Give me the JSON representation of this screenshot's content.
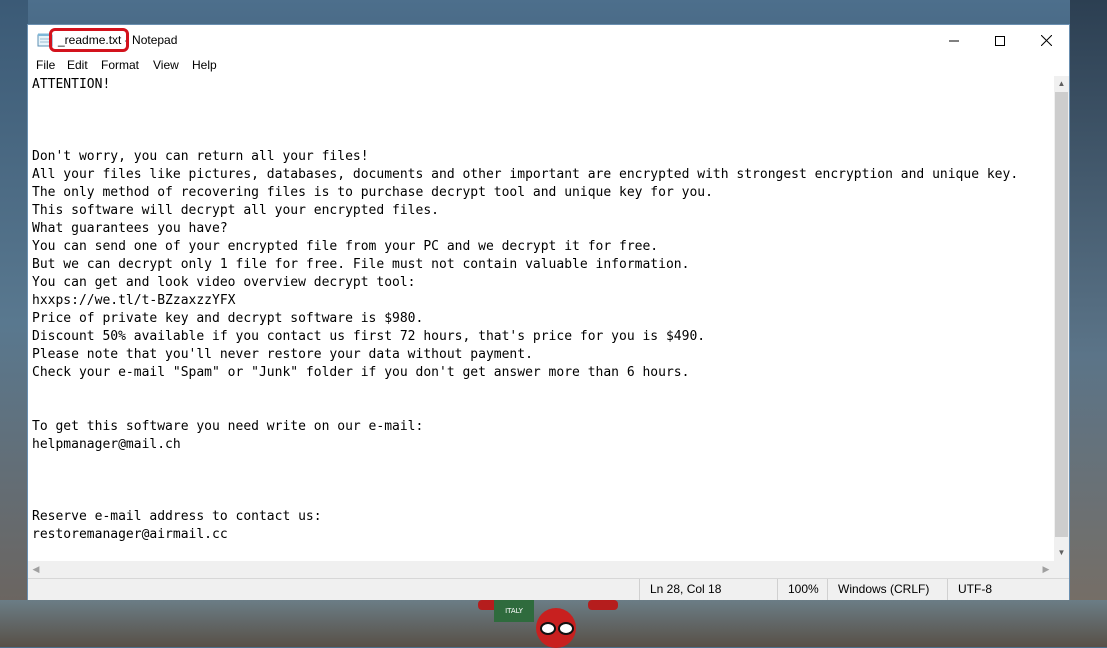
{
  "window": {
    "title": "_readme.txt - Notepad"
  },
  "controls": {
    "minimize": "–",
    "maximize": "☐",
    "close": "✕"
  },
  "menu": [
    "File",
    "Edit",
    "Format",
    "View",
    "Help"
  ],
  "document": {
    "lines": [
      "ATTENTION!",
      "",
      "",
      "",
      "Don't worry, you can return all your files!",
      "All your files like pictures, databases, documents and other important are encrypted with strongest encryption and unique key.",
      "The only method of recovering files is to purchase decrypt tool and unique key for you.",
      "This software will decrypt all your encrypted files.",
      "What guarantees you have?",
      "You can send one of your encrypted file from your PC and we decrypt it for free.",
      "But we can decrypt only 1 file for free. File must not contain valuable information.",
      "You can get and look video overview decrypt tool:",
      "hxxps://we.tl/t-BZzaxzzYFX",
      "Price of private key and decrypt software is $980.",
      "Discount 50% available if you contact us first 72 hours, that's price for you is $490.",
      "Please note that you'll never restore your data without payment.",
      "Check your e-mail \"Spam\" or \"Junk\" folder if you don't get answer more than 6 hours.",
      "",
      "",
      "To get this software you need write on our e-mail:",
      "helpmanager@mail.ch",
      "",
      "",
      "",
      "Reserve e-mail address to contact us:",
      "restoremanager@airmail.cc"
    ]
  },
  "status": {
    "position": "Ln 28, Col 18",
    "zoom": "100%",
    "line_ending": "Windows (CRLF)",
    "encoding": "UTF-8"
  },
  "background": {
    "poster_text": "ITALY"
  },
  "colors": {
    "highlight": "#d3121c",
    "window_border": "#6a8fb0"
  }
}
